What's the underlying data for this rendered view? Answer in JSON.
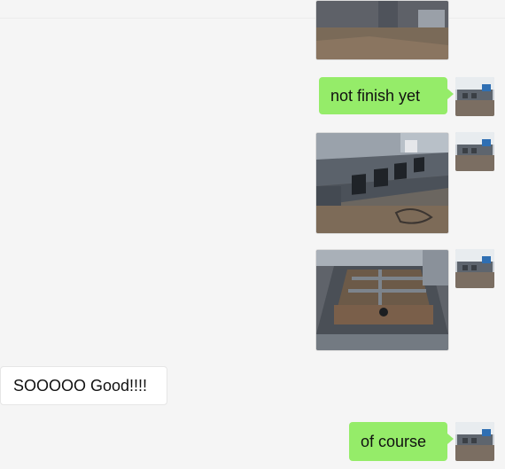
{
  "messages": [
    {
      "side": "out",
      "type": "image",
      "subject": "steel-frame-photo-partial"
    },
    {
      "side": "out",
      "type": "text",
      "text": "not finish yet"
    },
    {
      "side": "out",
      "type": "image",
      "subject": "steel-frame-side-photo"
    },
    {
      "side": "out",
      "type": "image",
      "subject": "steel-frame-top-photo"
    },
    {
      "side": "in",
      "type": "text",
      "text": "SOOOOO Good!!!!"
    },
    {
      "side": "out",
      "type": "text",
      "text": "of course"
    }
  ],
  "colors": {
    "background": "#f5f5f5",
    "outgoing_bubble": "#95ec69",
    "incoming_bubble": "#ffffff"
  },
  "icons": {
    "self_avatar": "factory-avatar-icon"
  }
}
